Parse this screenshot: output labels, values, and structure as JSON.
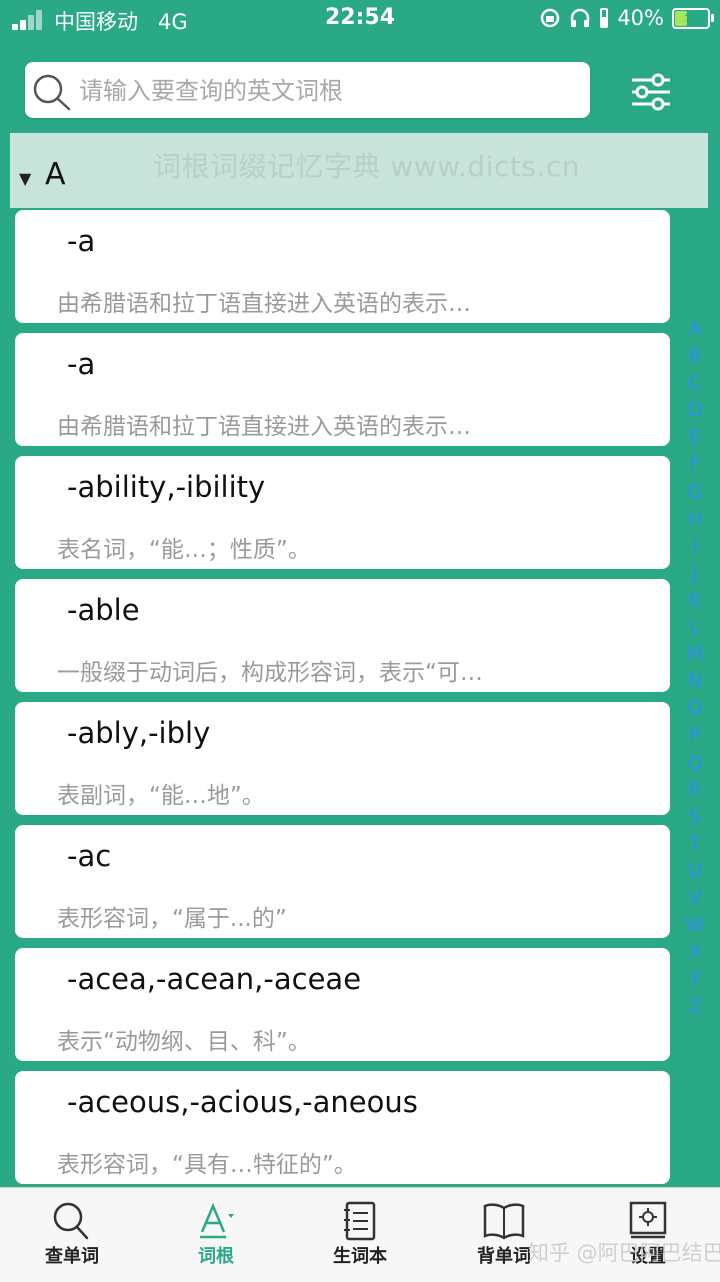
{
  "status_bar": {
    "carrier": "中国移动",
    "network": "4G",
    "time": "22:54",
    "battery": "40%",
    "battery_level": 0.4
  },
  "search": {
    "placeholder": "请输入要查询的英文词根"
  },
  "section": {
    "letter": "A",
    "watermark": "词根词缀记忆字典 www.dicts.cn"
  },
  "entries": [
    {
      "word": "-a",
      "desc": "由希腊语和拉丁语直接进入英语的表示…"
    },
    {
      "word": "-a",
      "desc": "由希腊语和拉丁语直接进入英语的表示…"
    },
    {
      "word": "-ability,-ibility",
      "desc": "表名词，“能…；性质”。"
    },
    {
      "word": "-able",
      "desc": "一般缀于动词后，构成形容词，表示“可…"
    },
    {
      "word": "-ably,-ibly",
      "desc": "表副词，“能…地”。"
    },
    {
      "word": "-ac",
      "desc": "表形容词，“属于...的”"
    },
    {
      "word": "-acea,-acean,-aceae",
      "desc": "表示“动物纲、目、科”。"
    },
    {
      "word": "-aceous,-acious,-aneous",
      "desc": "表形容词，“具有…特征的”。"
    }
  ],
  "alphabet_index": [
    "A",
    "B",
    "C",
    "D",
    "E",
    "F",
    "G",
    "H",
    "I",
    "J",
    "K",
    "L",
    "M",
    "N",
    "O",
    "P",
    "Q",
    "R",
    "S",
    "T",
    "U",
    "V",
    "W",
    "X",
    "Y",
    "Z"
  ],
  "tabs": [
    {
      "label": "查单词",
      "icon": "search-icon"
    },
    {
      "label": "词根",
      "icon": "root-letter-icon",
      "active": true
    },
    {
      "label": "生词本",
      "icon": "notebook-icon"
    },
    {
      "label": "背单词",
      "icon": "open-book-icon"
    },
    {
      "label": "设置",
      "icon": "settings-icon"
    }
  ],
  "overlay_watermark": "知乎 @阿巴阿巴结巴",
  "colors": {
    "theme": "#2aa986",
    "section_header": "#c8e3da",
    "index_letters": "#2f8cf0",
    "battery_fill": "#a6e65a"
  }
}
